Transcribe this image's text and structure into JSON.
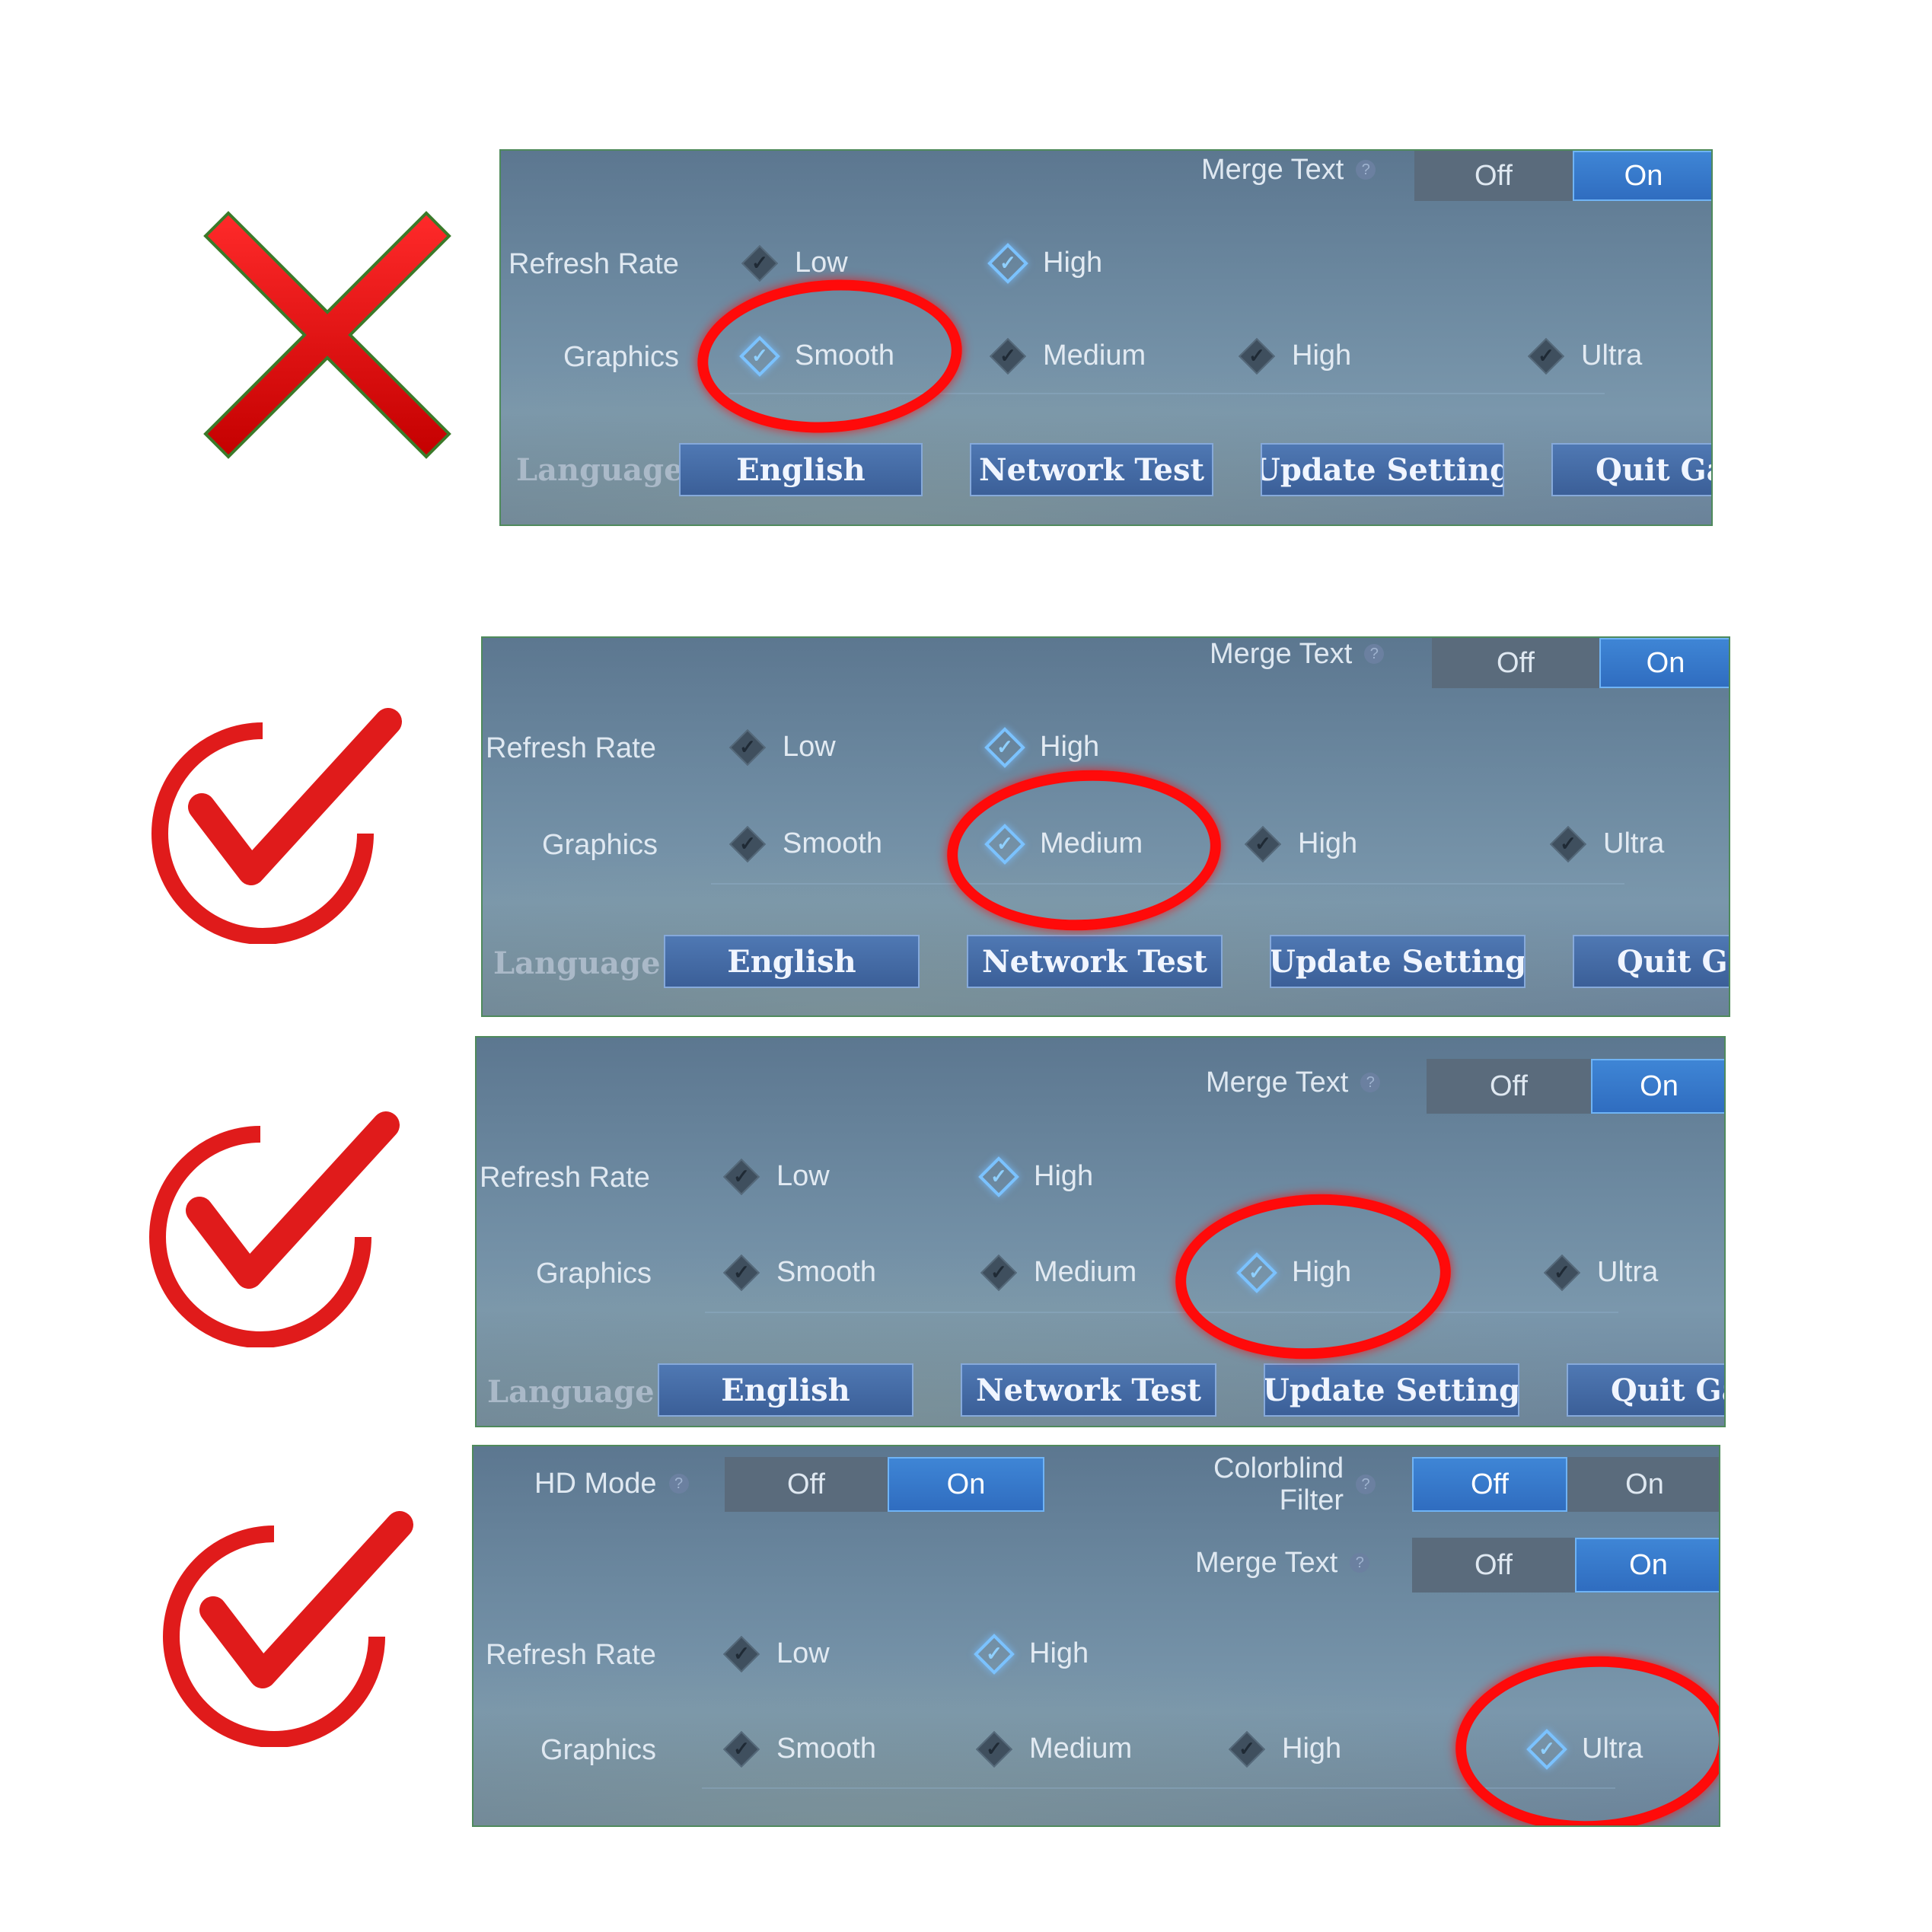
{
  "panel1": {
    "merge_text": "Merge Text",
    "off": "Off",
    "on": "On",
    "refresh_rate": "Refresh Rate",
    "rr_low": "Low",
    "rr_high": "High",
    "graphics": "Graphics",
    "g_smooth": "Smooth",
    "g_medium": "Medium",
    "g_high": "High",
    "g_ultra": "Ultra",
    "language": "Language",
    "english": "English",
    "network_test": "Network Test",
    "update_setting": "Update Setting",
    "quit_game": "Quit Gar"
  },
  "panel2": {
    "merge_text": "Merge Text",
    "off": "Off",
    "on": "On",
    "refresh_rate": "Refresh Rate",
    "rr_low": "Low",
    "rr_high": "High",
    "graphics": "Graphics",
    "g_smooth": "Smooth",
    "g_medium": "Medium",
    "g_high": "High",
    "g_ultra": "Ultra",
    "language": "Language",
    "english": "English",
    "network_test": "Network Test",
    "update_setting": "Update Setting",
    "quit_game": "Quit Ga"
  },
  "panel3": {
    "merge_text": "Merge Text",
    "off": "Off",
    "on": "On",
    "refresh_rate": "Refresh Rate",
    "rr_low": "Low",
    "rr_high": "High",
    "graphics": "Graphics",
    "g_smooth": "Smooth",
    "g_medium": "Medium",
    "g_high": "High",
    "g_ultra": "Ultra",
    "language": "Language",
    "english": "English",
    "network_test": "Network Test",
    "update_setting": "Update Setting",
    "quit_game": "Quit Ga"
  },
  "panel4": {
    "hd_mode": "HD Mode",
    "colorblind_1": "Colorblind",
    "colorblind_2": "Filter",
    "merge_text": "Merge Text",
    "off": "Off",
    "on": "On",
    "refresh_rate": "Refresh Rate",
    "rr_low": "Low",
    "rr_high": "High",
    "graphics": "Graphics",
    "g_smooth": "Smooth",
    "g_medium": "Medium",
    "g_high": "High",
    "g_ultra": "Ultra"
  },
  "help_glyph": "?",
  "colors": {
    "accent": "#2f6cbf",
    "annotation_red": "#ff0a0a",
    "mark_red": "#e01b1b"
  },
  "marks": [
    "wrong-x-icon",
    "correct-check-icon",
    "correct-check-icon",
    "correct-check-icon"
  ]
}
